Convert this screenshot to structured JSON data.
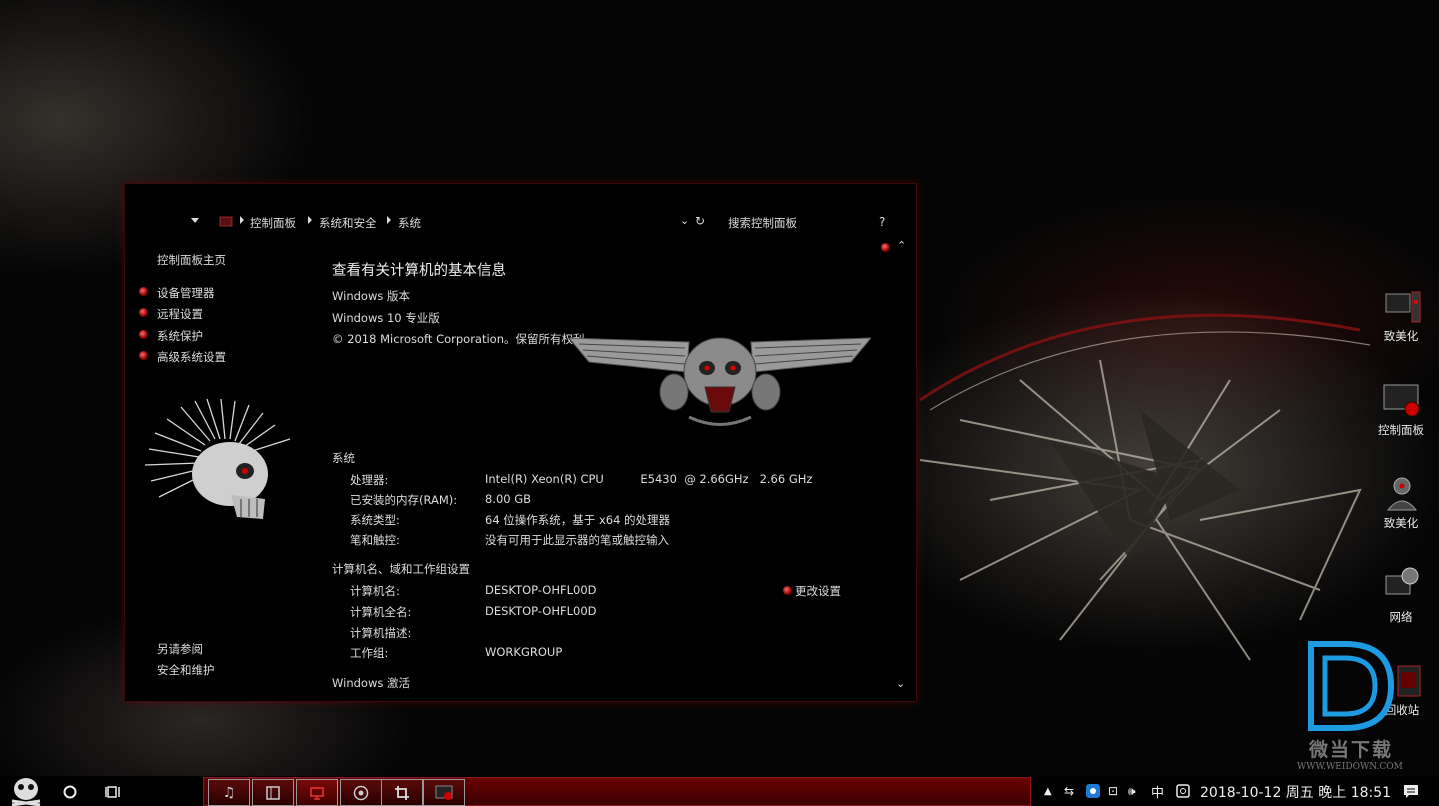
{
  "window": {
    "breadcrumb": [
      "控制面板",
      "系统和安全",
      "系统"
    ],
    "search_placeholder": "搜索控制面板",
    "help": "?",
    "sidebar": {
      "home": "控制面板主页",
      "links": [
        "设备管理器",
        "远程设置",
        "系统保护",
        "高级系统设置"
      ],
      "see_also_title": "另请参阅",
      "see_also": [
        "安全和维护"
      ]
    },
    "page_title": "查看有关计算机的基本信息",
    "edition": {
      "heading": "Windows 版本",
      "name": "Windows 10 专业版",
      "copyright": "© 2018 Microsoft Corporation。保留所有权利。"
    },
    "system": {
      "heading": "系统",
      "rows": [
        {
          "label": "处理器:",
          "value": "Intel(R) Xeon(R) CPU          E5430  @ 2.66GHz   2.66 GHz"
        },
        {
          "label": "已安装的内存(RAM):",
          "value": "8.00 GB"
        },
        {
          "label": "系统类型:",
          "value": "64 位操作系统，基于 x64 的处理器"
        },
        {
          "label": "笔和触控:",
          "value": "没有可用于此显示器的笔或触控输入"
        }
      ]
    },
    "computer": {
      "heading": "计算机名、域和工作组设置",
      "rows": [
        {
          "label": "计算机名:",
          "value": "DESKTOP-OHFL00D"
        },
        {
          "label": "计算机全名:",
          "value": "DESKTOP-OHFL00D"
        },
        {
          "label": "计算机描述:",
          "value": ""
        },
        {
          "label": "工作组:",
          "value": "WORKGROUP"
        }
      ],
      "change_settings": "更改设置"
    },
    "activation_heading": "Windows 激活"
  },
  "desktop_icons": [
    "致美化",
    "控制面板",
    "致美化",
    "网络",
    "回收站"
  ],
  "watermark": {
    "name": "微当下载",
    "url": "WWW.WEIDOWN.COM"
  },
  "taskbar": {
    "tray_ime": "中",
    "datetime": "2018-10-12 周五 晚上 18:51"
  },
  "colors": {
    "accent": "#8a0000",
    "window_bg": "#000000",
    "text": "#dddddd"
  }
}
